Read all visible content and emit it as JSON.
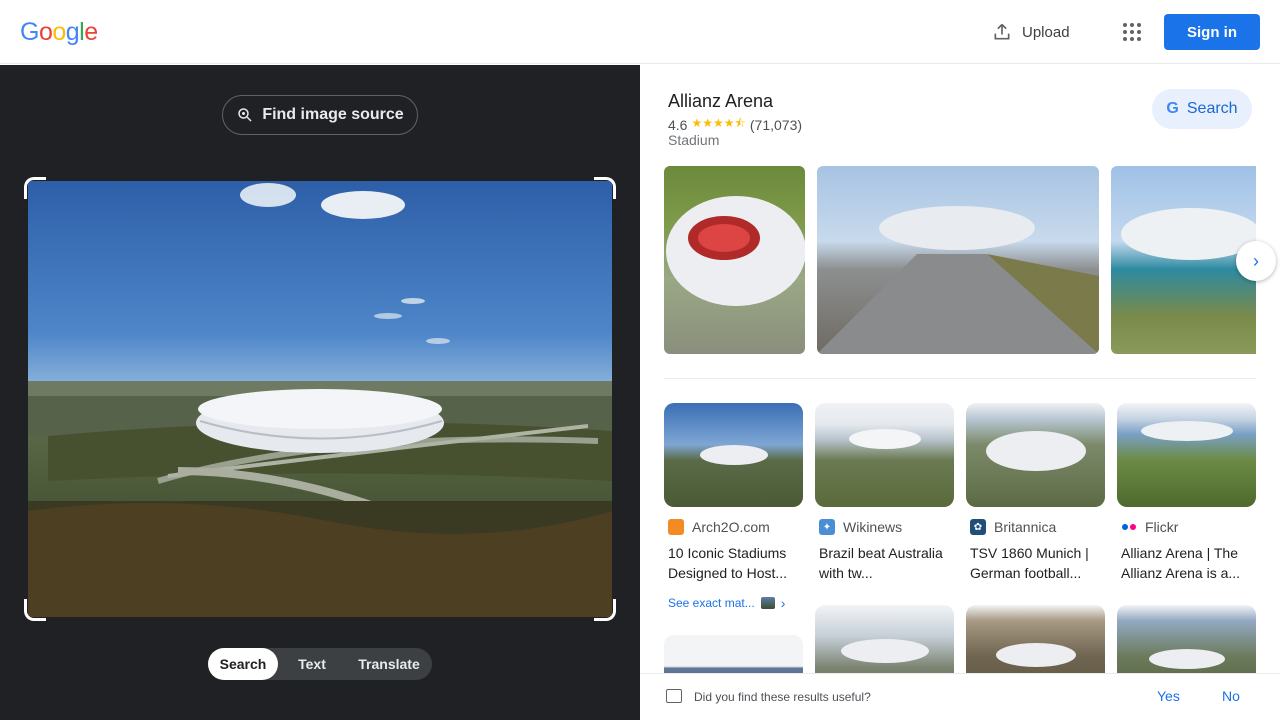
{
  "header": {
    "logo": [
      "G",
      "o",
      "o",
      "g",
      "l",
      "e"
    ],
    "logo_colors": [
      "#4285f4",
      "#ea4335",
      "#fbbc05",
      "#4285f4",
      "#34a853",
      "#ea4335"
    ],
    "upload_label": "Upload",
    "apps_icon": "apps-grid-icon",
    "signin_label": "Sign in"
  },
  "lens": {
    "find_source_label": "Find image source",
    "modes": [
      "Search",
      "Text",
      "Translate"
    ],
    "active_mode": "Search"
  },
  "knowledge_panel": {
    "title": "Allianz Arena",
    "rating": "4.6",
    "stars": "★★★★⯪",
    "reviews": "(71,073)",
    "type": "Stadium",
    "search_label": "Search"
  },
  "results": [
    {
      "source": "Arch2O.com",
      "title": "10 Iconic Stadiums Designed to Host...",
      "fav_color": "#f28b24",
      "fav_glyph": ""
    },
    {
      "source": "Wikinews",
      "title": "Brazil beat Australia with tw...",
      "fav_color": "#4a8fd6",
      "fav_glyph": "✦"
    },
    {
      "source": "Britannica",
      "title": "TSV 1860 Munich | German football...",
      "fav_color": "#1f4e79",
      "fav_glyph": "✿"
    },
    {
      "source": "Flickr",
      "title": "Allianz Arena | The Allianz Arena is a...",
      "fav_color": "#ffffff",
      "fav_glyph": ""
    }
  ],
  "exact_matches_label": "See exact mat...",
  "feedback": {
    "question": "Did you find these results useful?",
    "yes": "Yes",
    "no": "No"
  },
  "colors": {
    "accent": "#1a73e8",
    "dark_panel": "#202124"
  }
}
